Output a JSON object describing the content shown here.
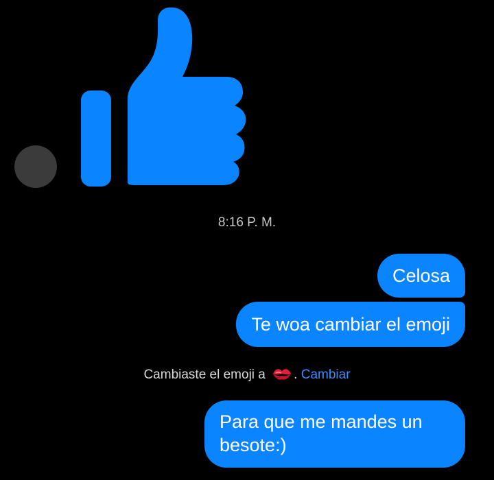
{
  "conversation": {
    "reaction_icon": "thumbs-up-icon",
    "avatar_icon": "avatar-icon",
    "timestamp": "8:16 P. M.",
    "messages": [
      {
        "text": "Celosa"
      },
      {
        "text": "Te woa cambiar el emoji"
      }
    ],
    "system_message": {
      "prefix": "Cambiaste el emoji a",
      "emoji": "kiss-mark-icon",
      "separator": ".",
      "action_label": "Cambiar"
    },
    "last_message": {
      "text": "Para que me mandes un besote:)"
    }
  },
  "colors": {
    "bubble": "#0a84ff",
    "background": "#000000",
    "link": "#3a8cff",
    "kiss": "#e0203a"
  }
}
